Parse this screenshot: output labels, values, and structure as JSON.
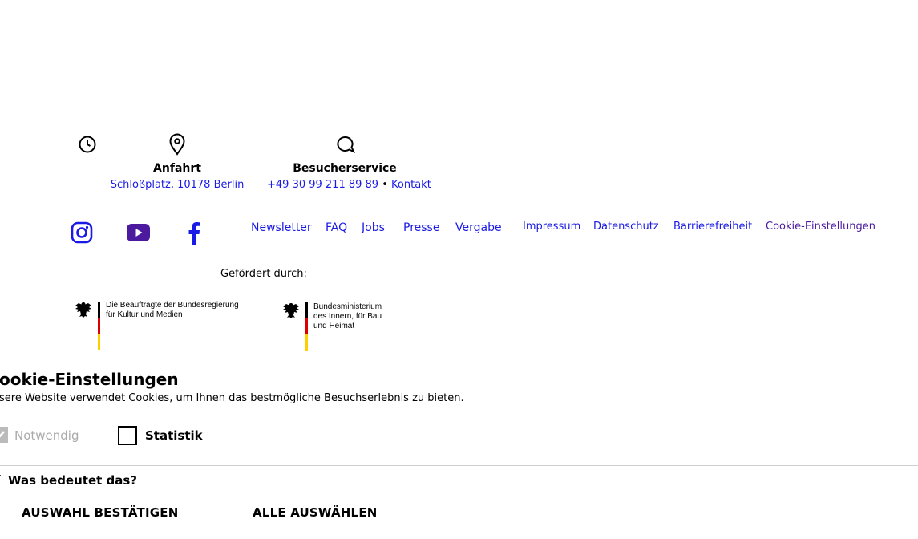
{
  "contact": {
    "hours_icon": "clock-icon",
    "directions": {
      "icon": "map-pin-icon",
      "title": "Anfahrt",
      "address": "Schloßplatz, 10178 Berlin"
    },
    "visitor_service": {
      "icon": "speech-bubble-icon",
      "title": "Besucherservice",
      "phone": "+49 30 99 211 89 89",
      "separator": "•",
      "contact_link": "Kontakt"
    }
  },
  "social": [
    {
      "name": "instagram-icon",
      "color": "#1a1ae6"
    },
    {
      "name": "youtube-icon",
      "color": "#4b1a9e"
    },
    {
      "name": "facebook-icon",
      "color": "#1a1ae6"
    }
  ],
  "nav_links": [
    "Newsletter",
    "FAQ",
    "Jobs",
    "Presse",
    "Vergabe"
  ],
  "legal_links": [
    "Impressum",
    "Datenschutz",
    "Barrierefreiheit",
    "Cookie-Einstellungen"
  ],
  "funding": {
    "label": "Gefördert durch:",
    "logo1": {
      "line1": "Die Beauftragte der Bundesregierung",
      "line2": "für Kultur und Medien"
    },
    "logo2": {
      "line1": "Bundesministerium",
      "line2": "des Innern, für Bau",
      "line3": "und Heimat"
    }
  },
  "cookie": {
    "title": "ookie-Einstellungen",
    "description": "sere Website verwendet Cookies, um Ihnen das bestmögliche Besuchserlebnis zu bieten.",
    "options": [
      {
        "label": "Notwendig",
        "checked": true,
        "disabled": true
      },
      {
        "label": "Statistik",
        "checked": false,
        "disabled": false
      }
    ],
    "info_toggle": "Was bedeutet das?",
    "confirm_button": "AUSWAHL BESTÄTIGEN",
    "select_all_button": "ALLE AUSWÄHLEN"
  },
  "colors": {
    "link": "#1a1ae6",
    "visited_link": "#4b1a9e",
    "flag_black": "#000000",
    "flag_red": "#dd0000",
    "flag_gold": "#ffce00"
  }
}
